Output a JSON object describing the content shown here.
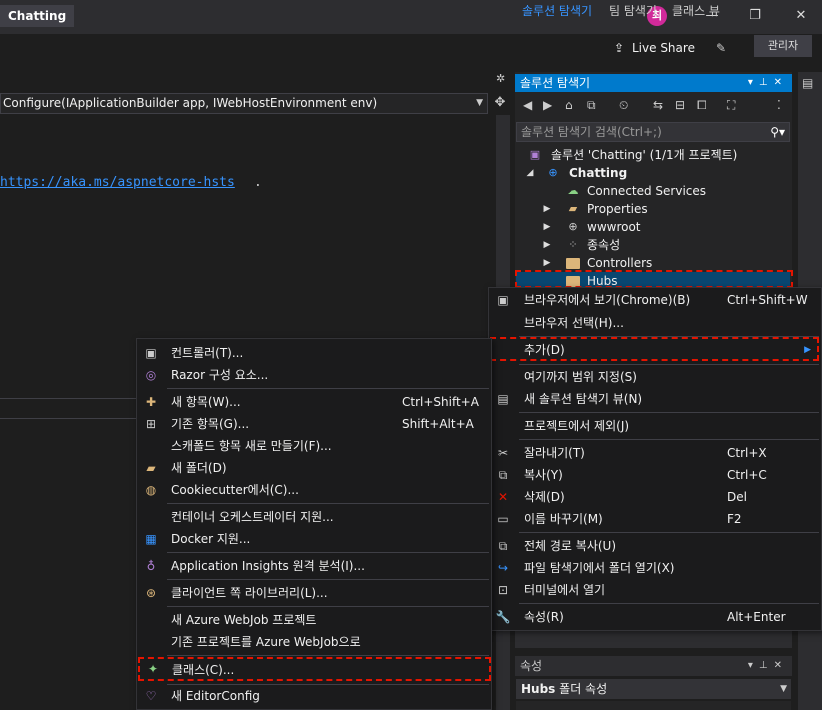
{
  "titlebar": {
    "app_title": "Chatting",
    "avatar_initial": "최",
    "live_share": "Live Share",
    "admin_badge": "관리자"
  },
  "editor": {
    "method_signature": "Configure(IApplicationBuilder app, IWebHostEnvironment env)",
    "code_link": "https://aka.ms/aspnetcore-hsts",
    "code_punct": "."
  },
  "solution_explorer": {
    "title": "솔루션 탐색기",
    "search_placeholder": "솔루션 탐색기 검색(Ctrl+;)",
    "tree": [
      {
        "label": "솔루션 'Chatting' (1/1개 프로젝트)"
      },
      {
        "label": "Chatting"
      },
      {
        "label": "Connected Services"
      },
      {
        "label": "Properties"
      },
      {
        "label": "wwwroot"
      },
      {
        "label": "종속성"
      },
      {
        "label": "Controllers"
      },
      {
        "label": "Hubs"
      }
    ],
    "tabs": [
      "솔루션 탐색기",
      "팀 탐색기",
      "클래스 뷰"
    ]
  },
  "properties": {
    "title": "속성",
    "object_name": "Hubs",
    "object_type": "폴더 속성"
  },
  "context_menu": {
    "items": [
      {
        "label": "브라우저에서 보기(Chrome)(B)",
        "shortcut": "Ctrl+Shift+W",
        "icon": "browser-view-icon"
      },
      {
        "label": "브라우저 선택(H)...",
        "shortcut": "",
        "icon": ""
      },
      {
        "label": "추가(D)",
        "shortcut": "",
        "icon": ""
      },
      {
        "label": "여기까지 범위 지정(S)",
        "shortcut": "",
        "icon": ""
      },
      {
        "label": "새 솔루션 탐색기 뷰(N)",
        "shortcut": "",
        "icon": "new-view-icon"
      },
      {
        "label": "프로젝트에서 제외(J)",
        "shortcut": "",
        "icon": ""
      },
      {
        "label": "잘라내기(T)",
        "shortcut": "Ctrl+X",
        "icon": "cut-icon"
      },
      {
        "label": "복사(Y)",
        "shortcut": "Ctrl+C",
        "icon": "copy-icon"
      },
      {
        "label": "삭제(D)",
        "shortcut": "Del",
        "icon": "delete-icon"
      },
      {
        "label": "이름 바꾸기(M)",
        "shortcut": "F2",
        "icon": "rename-icon"
      },
      {
        "label": "전체 경로 복사(U)",
        "shortcut": "",
        "icon": "copy-path-icon"
      },
      {
        "label": "파일 탐색기에서 폴더 열기(X)",
        "shortcut": "",
        "icon": "open-folder-icon"
      },
      {
        "label": "터미널에서 열기",
        "shortcut": "",
        "icon": "terminal-icon"
      },
      {
        "label": "속성(R)",
        "shortcut": "Alt+Enter",
        "icon": "wrench-icon"
      }
    ]
  },
  "add_submenu": {
    "items": [
      {
        "label": "컨트롤러(T)...",
        "shortcut": ""
      },
      {
        "label": "Razor 구성 요소...",
        "shortcut": ""
      },
      {
        "label": "새 항목(W)...",
        "shortcut": "Ctrl+Shift+A"
      },
      {
        "label": "기존 항목(G)...",
        "shortcut": "Shift+Alt+A"
      },
      {
        "label": "스캐폴드 항목 새로 만들기(F)...",
        "shortcut": ""
      },
      {
        "label": "새 폴더(D)",
        "shortcut": ""
      },
      {
        "label": "Cookiecutter에서(C)...",
        "shortcut": ""
      },
      {
        "label": "컨테이너 오케스트레이터 지원...",
        "shortcut": ""
      },
      {
        "label": "Docker 지원...",
        "shortcut": ""
      },
      {
        "label": "Application Insights 원격 분석(I)...",
        "shortcut": ""
      },
      {
        "label": "클라이언트 쪽 라이브러리(L)...",
        "shortcut": ""
      },
      {
        "label": "새 Azure WebJob 프로젝트",
        "shortcut": ""
      },
      {
        "label": "기존 프로젝트를 Azure WebJob으로",
        "shortcut": ""
      },
      {
        "label": "클래스(C)...",
        "shortcut": ""
      },
      {
        "label": "새 EditorConfig",
        "shortcut": ""
      }
    ]
  },
  "colors": {
    "accent": "#007acc",
    "highlight_border": "#e51400",
    "link": "#3794ff"
  }
}
